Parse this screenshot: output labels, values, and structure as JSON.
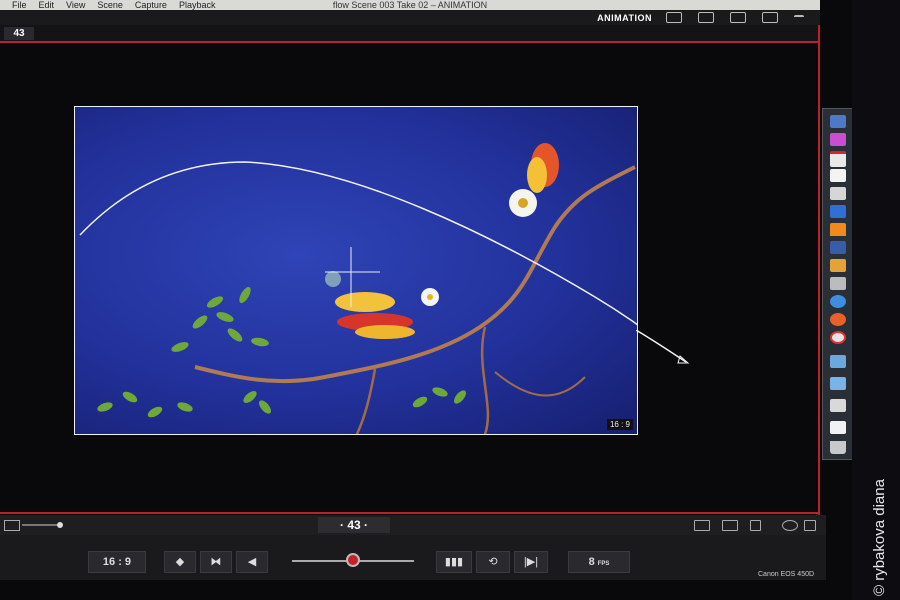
{
  "menubar": {
    "items": [
      "File",
      "Edit",
      "View",
      "Scene",
      "Capture",
      "Playback"
    ],
    "window_title": "flow  Scene 003  Take 02 – ANIMATION"
  },
  "toolbar": {
    "mode_label": "ANIMATION",
    "icons": [
      "monitor-icon",
      "camera-icon",
      "image-icon",
      "sliders-icon",
      "dropdown-icon"
    ]
  },
  "frame": {
    "current": "43",
    "bottom_label": "· 43 ·"
  },
  "viewer": {
    "ratio_badge": "16 : 9"
  },
  "controls": {
    "ratio": "16 : 9",
    "fps_value": "8",
    "fps_unit": "FPS",
    "playhead_position": 0.5
  },
  "camera_label": "Canon EOS 450D",
  "watermark": "© rybakova diana",
  "colors": {
    "accent_red": "#b8232b",
    "image_blue": "#22319b"
  },
  "dock": {
    "icons": [
      "preview-icon",
      "premiere-icon",
      "calendar-icon",
      "text-icon",
      "illustrator-icon",
      "photoshop-icon",
      "vlc-icon",
      "aftereffects-icon",
      "photo-icon",
      "chat-icon",
      "browser-icon",
      "firefox-icon",
      "chrome-icon",
      "folder-icon",
      "folder-icon",
      "folder-icon",
      "document-icon",
      "trash-icon"
    ]
  }
}
